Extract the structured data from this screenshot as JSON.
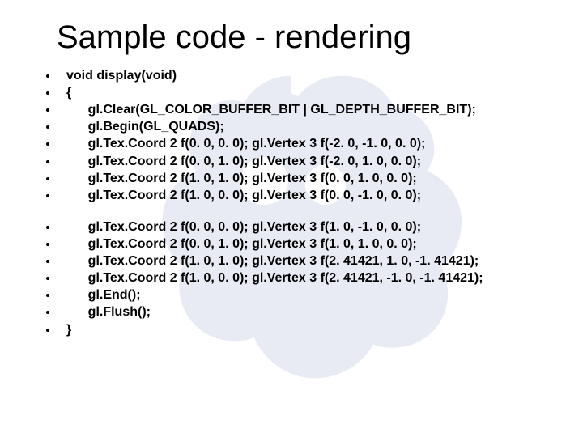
{
  "title": "Sample code - rendering",
  "block1": [
    "void display(void)",
    "{",
    "      gl.Clear(GL_COLOR_BUFFER_BIT | GL_DEPTH_BUFFER_BIT);",
    "      gl.Begin(GL_QUADS);",
    "      gl.Tex.Coord 2 f(0. 0, 0. 0); gl.Vertex 3 f(-2. 0, -1. 0, 0. 0);",
    "      gl.Tex.Coord 2 f(0. 0, 1. 0); gl.Vertex 3 f(-2. 0, 1. 0, 0. 0);",
    "      gl.Tex.Coord 2 f(1. 0, 1. 0); gl.Vertex 3 f(0. 0, 1. 0, 0. 0);",
    "      gl.Tex.Coord 2 f(1. 0, 0. 0); gl.Vertex 3 f(0. 0, -1. 0, 0. 0);"
  ],
  "block2": [
    "      gl.Tex.Coord 2 f(0. 0, 0. 0); gl.Vertex 3 f(1. 0, -1. 0, 0. 0);",
    "      gl.Tex.Coord 2 f(0. 0, 1. 0); gl.Vertex 3 f(1. 0, 1. 0, 0. 0);",
    "      gl.Tex.Coord 2 f(1. 0, 1. 0); gl.Vertex 3 f(2. 41421, 1. 0, -1. 41421);",
    "      gl.Tex.Coord 2 f(1. 0, 0. 0); gl.Vertex 3 f(2. 41421, -1. 0, -1. 41421);",
    "      gl.End();",
    "      gl.Flush();",
    "}"
  ]
}
